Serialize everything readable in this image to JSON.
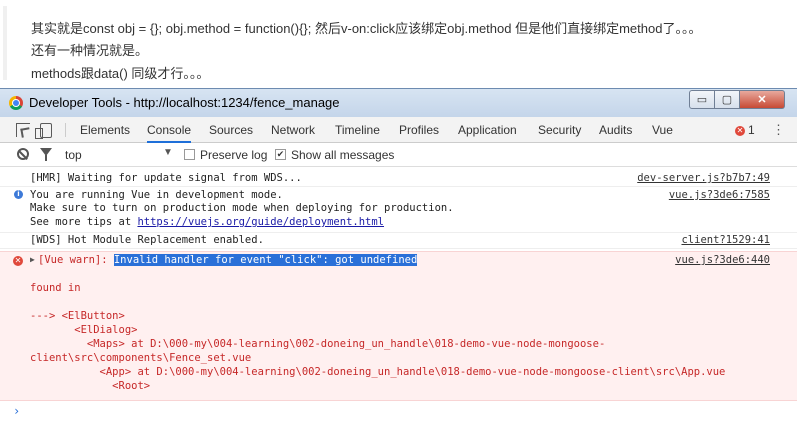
{
  "page": {
    "line1": "其实就是const obj = {}; obj.method = function(){}; 然后v-on:click应该绑定obj.method 但是他们直接绑定method了。。。",
    "line2": "还有一种情况就是。",
    "line3": "methods跟data() 同级才行。。。"
  },
  "window": {
    "title": "Developer Tools - http://localhost:1234/fence_manage",
    "min_label": "▭",
    "max_label": "▢",
    "close_label": "✕"
  },
  "tabs": {
    "items": [
      "Elements",
      "Console",
      "Sources",
      "Network",
      "Timeline",
      "Profiles",
      "Application",
      "Security",
      "Audits",
      "Vue"
    ],
    "active": "Console",
    "error_count": "1",
    "error_icon_glyph": "✕",
    "menu_glyph": "⋮"
  },
  "filter": {
    "context": "top",
    "dropdown_glyph": "▼",
    "preserve_log_label": "Preserve log",
    "preserve_log_checked": false,
    "show_all_label": "Show all messages",
    "show_all_checked": true,
    "show_all_glyph": "✔"
  },
  "console": {
    "messages": [
      {
        "text": "[HMR] Waiting for update signal from WDS...",
        "source": "dev-server.js?b7b7:49"
      },
      {
        "lines": [
          "You are running Vue in development mode.",
          "Make sure to turn on production mode when deploying for production.",
          "See more tips at "
        ],
        "link": "https://vuejs.org/guide/deployment.html",
        "source": "vue.js?3de6:7585",
        "icon_glyph": "i"
      },
      {
        "text": "[WDS] Hot Module Replacement enabled.",
        "source": "client?1529:41"
      }
    ],
    "error": {
      "expand_glyph": "▶",
      "icon_glyph": "✕",
      "prefix": "[Vue warn]: ",
      "highlight": "Invalid handler for event \"click\": got undefined",
      "source": "vue.js?3de6:440",
      "trace": [
        "",
        "found in",
        "",
        "---> <ElButton>",
        "       <ElDialog>",
        "         <Maps> at D:\\000-my\\004-learning\\002-doneing_un_handle\\018-demo-vue-node-mongoose-",
        "client\\src\\components\\Fence_set.vue",
        "           <App> at D:\\000-my\\004-learning\\002-doneing_un_handle\\018-demo-vue-node-mongoose-client\\src\\App.vue",
        "             <Root>"
      ]
    },
    "prompt": "›"
  }
}
